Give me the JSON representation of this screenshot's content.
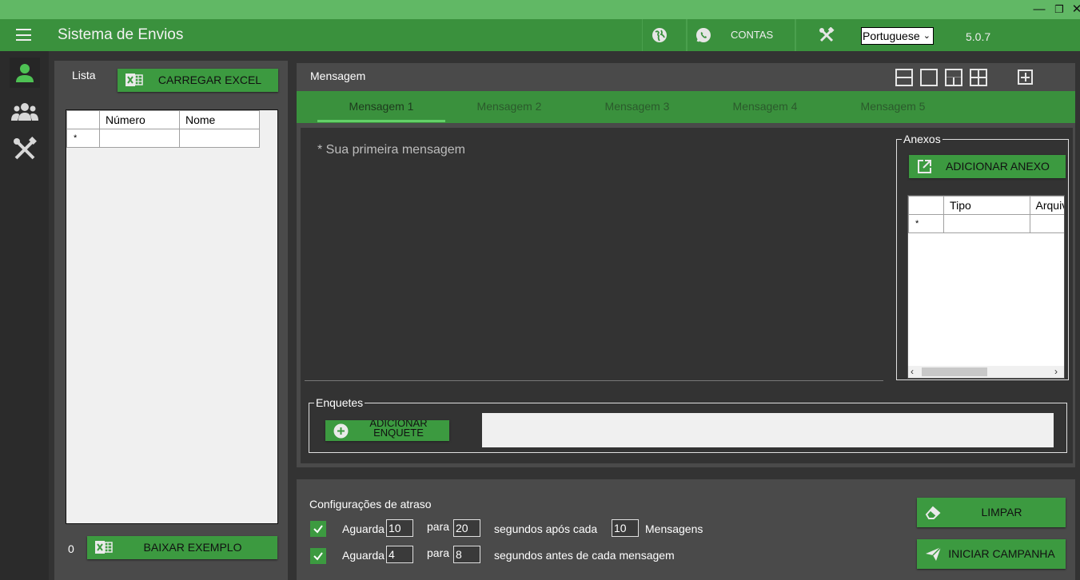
{
  "app": {
    "title": "Sistema de Envios",
    "contas_label": "CONTAS",
    "language": "Portuguese",
    "version": "5.0.7"
  },
  "window_controls": {
    "minimize": "—",
    "restore": "❐",
    "close": "✕"
  },
  "colors": {
    "accent": "#3a913d",
    "button": "#3c9a40",
    "active_icon": "#4ec154",
    "panel": "#4a4a4a"
  },
  "list": {
    "label": "Lista",
    "load_excel_label": "CARREGAR EXCEL",
    "columns": [
      "Número",
      "Nome"
    ],
    "new_row_marker": "*",
    "count": "0",
    "download_example_label": "BAIXAR EXEMPLO"
  },
  "message": {
    "label": "Mensagem",
    "tabs": [
      "Mensagem 1",
      "Mensagem 2",
      "Mensagem 3",
      "Mensagem 4",
      "Mensagem 5"
    ],
    "placeholder": "* Sua primeira mensagem"
  },
  "attachments": {
    "legend": "Anexos",
    "add_label": "ADICIONAR ANEXO",
    "columns": [
      "Tipo",
      "Arquivo"
    ],
    "new_row_marker": "*"
  },
  "polls": {
    "legend": "Enquetes",
    "add_label": "ADICIONAR ENQUETE"
  },
  "delay": {
    "title": "Configurações de atraso",
    "row1": {
      "wait": "Aguarda",
      "from": "10",
      "to_label": "para",
      "to": "20",
      "text": "segundos após cada",
      "count": "10",
      "suffix": "Mensagens"
    },
    "row2": {
      "wait": "Aguarda",
      "from": "4",
      "to_label": "para",
      "to": "8",
      "text": "segundos antes de cada mensagem"
    },
    "clear_label": "LIMPAR",
    "start_label": "INICIAR CAMPANHA"
  }
}
